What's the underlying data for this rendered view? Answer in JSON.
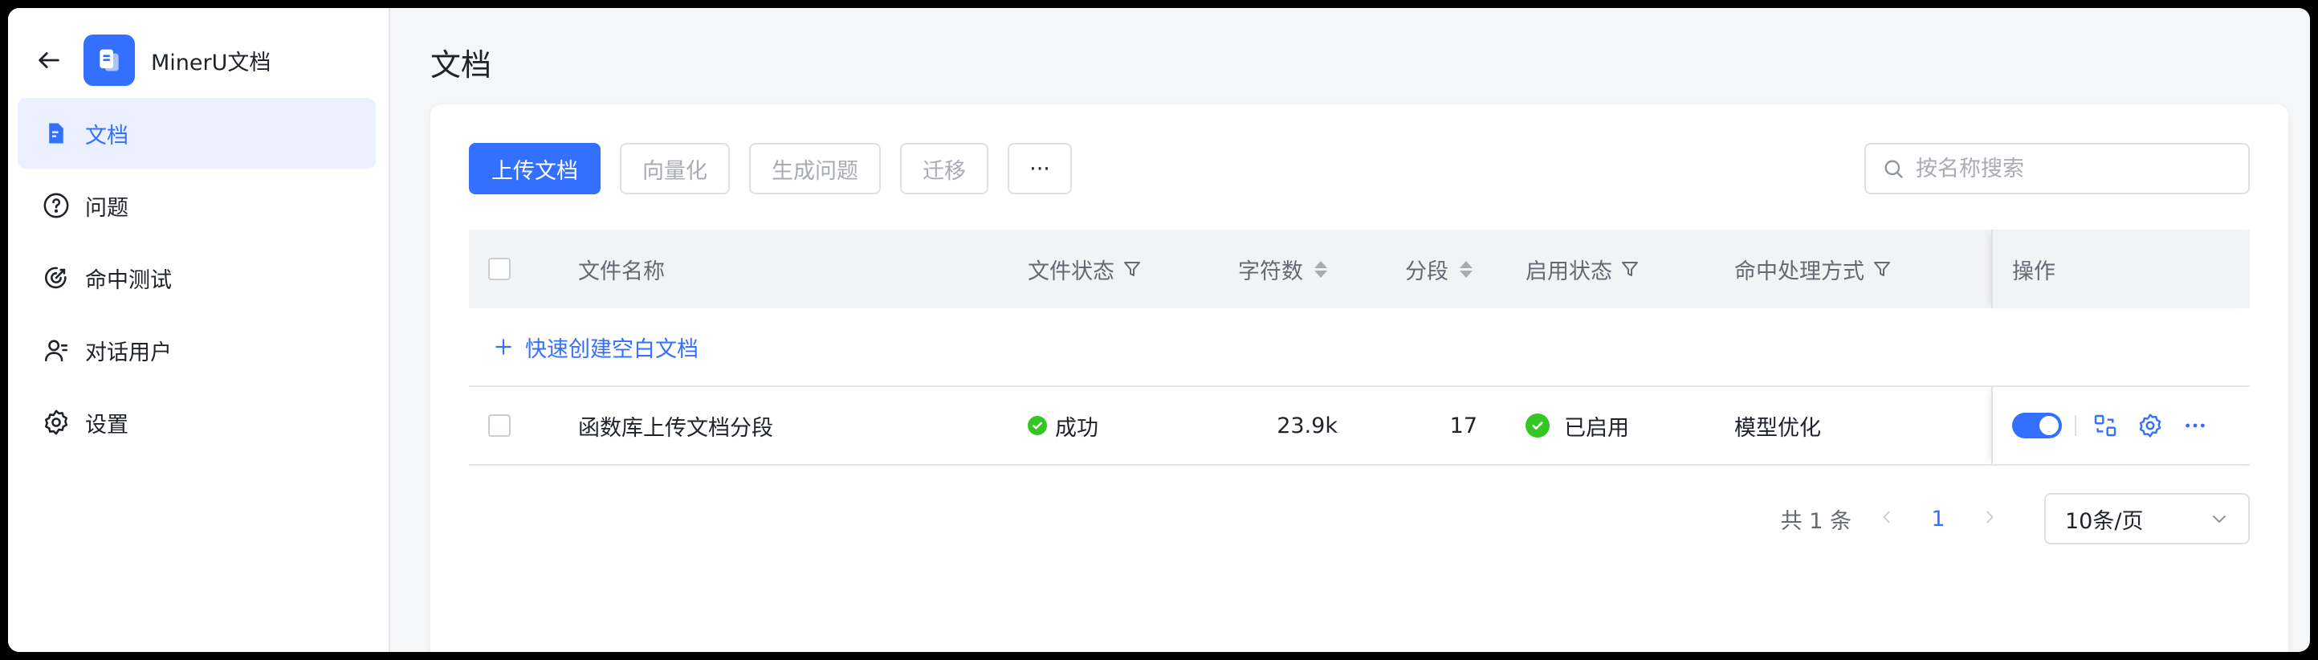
{
  "app": {
    "name": "MinerU文档"
  },
  "sidebar": {
    "items": [
      {
        "label": "文档",
        "icon": "document-icon",
        "active": true
      },
      {
        "label": "问题",
        "icon": "question-icon"
      },
      {
        "label": "命中测试",
        "icon": "target-icon"
      },
      {
        "label": "对话用户",
        "icon": "user-icon"
      },
      {
        "label": "设置",
        "icon": "gear-icon"
      }
    ]
  },
  "page": {
    "title": "文档"
  },
  "toolbar": {
    "upload_label": "上传文档",
    "vectorize_label": "向量化",
    "generate_label": "生成问题",
    "migrate_label": "迁移",
    "more_label": "···"
  },
  "search": {
    "placeholder": "按名称搜索",
    "value": ""
  },
  "table": {
    "columns": {
      "name": "文件名称",
      "file_status": "文件状态",
      "char_count": "字符数",
      "segments": "分段",
      "enable_status": "启用状态",
      "hit_mode": "命中处理方式",
      "ops": "操作"
    },
    "quick_create": "快速创建空白文档",
    "rows": [
      {
        "name": "函数库上传文档分段",
        "file_status": "成功",
        "char_count": "23.9k",
        "segments": "17",
        "enable_status": "已启用",
        "hit_mode": "模型优化",
        "enabled": true
      }
    ]
  },
  "pagination": {
    "total_label": "共 1 条",
    "current_page": "1",
    "page_size": "10条/页"
  },
  "colors": {
    "primary": "#3370ff",
    "success": "#34c724",
    "active_nav_bg": "#eaf0ff"
  }
}
